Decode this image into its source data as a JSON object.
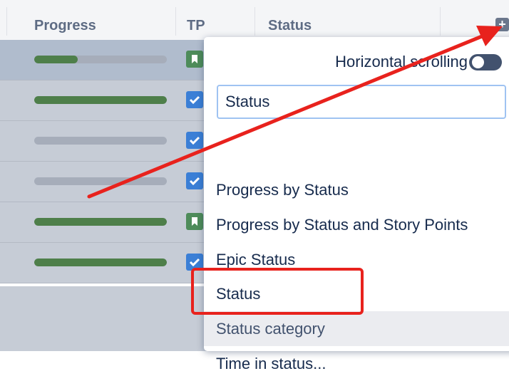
{
  "table": {
    "columns": [
      {
        "label": "Progress"
      },
      {
        "label": "TP"
      },
      {
        "label": "Status"
      }
    ],
    "add_column_icon": "plus-square-icon",
    "rows": [
      {
        "progress": 0.33,
        "type_icon": "bookmark-icon",
        "selected": true
      },
      {
        "progress": 1.0,
        "type_icon": "checkbox-icon",
        "selected": false
      },
      {
        "progress": 0.0,
        "type_icon": "checkbox-icon",
        "selected": false
      },
      {
        "progress": 0.0,
        "type_icon": "checkbox-icon",
        "selected": false
      },
      {
        "progress": 1.0,
        "type_icon": "bookmark-icon",
        "selected": false
      },
      {
        "progress": 1.0,
        "type_icon": "checkbox-icon",
        "selected": false
      }
    ]
  },
  "popup": {
    "horizontal_scrolling_label": "Horizontal scrolling",
    "horizontal_scrolling_on": false,
    "search_value": "Status",
    "options": [
      {
        "label": "Progress by Status"
      },
      {
        "label": "Progress by Status and Story Points"
      },
      {
        "label": "Epic Status"
      },
      {
        "label": "Status"
      },
      {
        "label": "Status category"
      },
      {
        "label": "Time in status..."
      }
    ],
    "hovered_option": "Status category"
  },
  "colors": {
    "annotation_red": "#e8221d",
    "progress_green": "#4e7f4a",
    "story_green": "#4e8c5a",
    "task_blue": "#3b7fd6"
  }
}
